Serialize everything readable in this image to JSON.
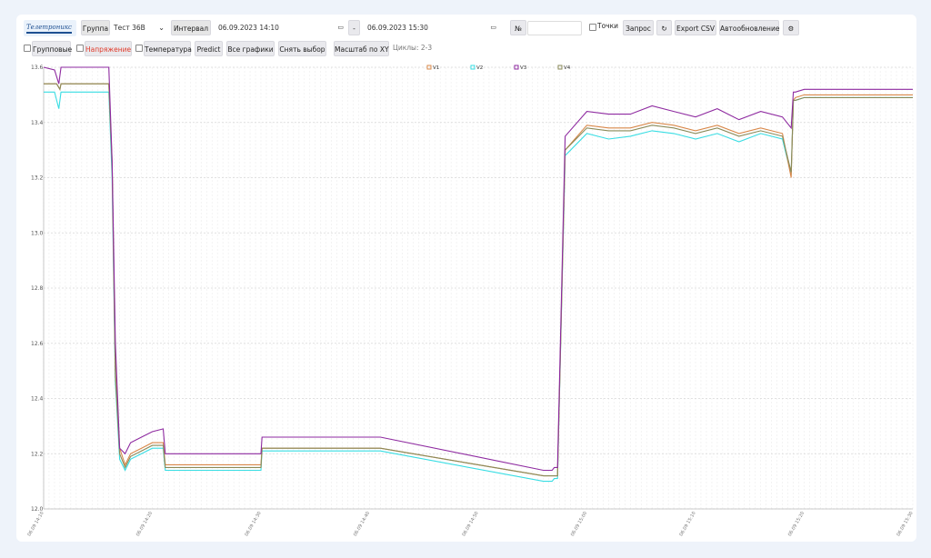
{
  "toolbar": {
    "logo_text": "Телетроникс",
    "group_label": "Группа",
    "group_value": "Тест 36В",
    "interval_label": "Интервал",
    "date_from": "06.09.2023 14:10",
    "date_sep": "-",
    "date_to": "06.09.2023 15:30",
    "number_label": "№",
    "number_value": "",
    "points_label": "Точки",
    "request_label": "Запрос",
    "refresh_icon": "refresh-icon",
    "export_label": "Export CSV",
    "autoupdate_label": "Автообновление",
    "settings_icon": "gear-icon"
  },
  "toolbar2": {
    "group_btn": "Групповые",
    "voltage_btn": "Напряжение",
    "temperature_btn": "Температура",
    "predict_btn": "Predict",
    "all_charts_btn": "Все графики",
    "deselect_btn": "Снять выбор",
    "scale_btn": "Масштаб по XY",
    "cycles_label": "Циклы: 2-3"
  },
  "colors": {
    "V1": "#d9884a",
    "V2": "#37dde3",
    "V3": "#8e2aa0",
    "V4": "#8a8a58",
    "active_tab_text": "#e03a2a"
  },
  "chart_data": {
    "type": "line",
    "title": "",
    "xlabel": "",
    "ylabel": "",
    "ylim": [
      12.0,
      13.6
    ],
    "yticks": [
      12.0,
      12.2,
      12.4,
      12.6,
      12.8,
      13.0,
      13.2,
      13.4,
      13.6
    ],
    "grid": true,
    "legend": "top-center",
    "x_range_minutes": [
      0,
      80
    ],
    "x_tick_labels": [
      "06.09 14:10",
      "06.09 14:20",
      "06.09 14:30",
      "06.09 14:40",
      "06.09 14:50",
      "06.09 15:00",
      "06.09 15:10",
      "06.09 15:20",
      "06.09 15:30"
    ],
    "series": [
      {
        "name": "V1",
        "x": [
          0,
          1.2,
          1.5,
          1.6,
          6.0,
          6.3,
          6.6,
          7.0,
          7.5,
          8.0,
          9.0,
          10.0,
          11.0,
          11.2,
          14.5,
          17.0,
          19.0,
          20.0,
          20.1,
          31.0,
          46.0,
          46.8,
          47.0,
          47.3,
          48.0,
          50,
          52,
          54,
          56,
          58,
          60,
          62,
          64,
          66,
          68,
          68.8,
          69.0,
          69.2,
          70,
          74,
          78,
          80
        ],
        "y": [
          13.54,
          13.54,
          13.52,
          13.54,
          13.54,
          13.26,
          12.5,
          12.22,
          12.16,
          12.2,
          12.22,
          12.24,
          12.24,
          12.16,
          12.16,
          12.16,
          12.16,
          12.16,
          12.22,
          12.22,
          12.12,
          12.12,
          12.12,
          12.12,
          13.3,
          13.39,
          13.38,
          13.38,
          13.4,
          13.39,
          13.37,
          13.39,
          13.36,
          13.38,
          13.36,
          13.2,
          13.48,
          13.49,
          13.5,
          13.5,
          13.5,
          13.5
        ]
      },
      {
        "name": "V2",
        "x": [
          0,
          1.0,
          1.4,
          1.6,
          6.0,
          6.3,
          6.6,
          7.0,
          7.5,
          8.0,
          9.0,
          10.0,
          11.0,
          11.2,
          14.5,
          17.0,
          19.0,
          20.0,
          20.1,
          31.0,
          46.0,
          46.8,
          47.0,
          47.3,
          48.0,
          50,
          52,
          54,
          56,
          58,
          60,
          62,
          64,
          66,
          68,
          68.8,
          69.0,
          69.2,
          70,
          74,
          78,
          80
        ],
        "y": [
          13.51,
          13.51,
          13.45,
          13.51,
          13.51,
          13.2,
          12.46,
          12.18,
          12.14,
          12.18,
          12.2,
          12.22,
          12.22,
          12.14,
          12.14,
          12.14,
          12.14,
          12.14,
          12.21,
          12.21,
          12.1,
          12.1,
          12.11,
          12.11,
          13.28,
          13.36,
          13.34,
          13.35,
          13.37,
          13.36,
          13.34,
          13.36,
          13.33,
          13.36,
          13.34,
          13.21,
          13.48,
          13.48,
          13.49,
          13.49,
          13.49,
          13.49
        ]
      },
      {
        "name": "V3",
        "x": [
          0,
          1.0,
          1.4,
          1.6,
          6.0,
          6.3,
          6.6,
          7.0,
          7.5,
          8.0,
          9.0,
          10.0,
          11.0,
          11.2,
          14.5,
          17.0,
          19.0,
          20.0,
          20.1,
          31.0,
          46.0,
          46.8,
          47.0,
          47.3,
          48.0,
          50,
          52,
          54,
          56,
          58,
          60,
          62,
          64,
          66,
          68,
          68.8,
          69.0,
          69.2,
          70,
          74,
          78,
          80
        ],
        "y": [
          13.6,
          13.59,
          13.54,
          13.6,
          13.6,
          13.26,
          12.6,
          12.22,
          12.2,
          12.24,
          12.26,
          12.28,
          12.29,
          12.2,
          12.2,
          12.2,
          12.2,
          12.2,
          12.26,
          12.26,
          12.14,
          12.14,
          12.15,
          12.15,
          13.35,
          13.44,
          13.43,
          13.43,
          13.46,
          13.44,
          13.42,
          13.45,
          13.41,
          13.44,
          13.42,
          13.38,
          13.51,
          13.51,
          13.52,
          13.52,
          13.52,
          13.52
        ]
      },
      {
        "name": "V4",
        "x": [
          0,
          1.2,
          1.5,
          1.6,
          6.0,
          6.3,
          6.6,
          7.0,
          7.5,
          8.0,
          9.0,
          10.0,
          11.0,
          11.2,
          14.5,
          17.0,
          19.0,
          20.0,
          20.1,
          31.0,
          46.0,
          46.8,
          47.0,
          47.3,
          48.0,
          50,
          52,
          54,
          56,
          58,
          60,
          62,
          64,
          66,
          68,
          68.8,
          69.0,
          69.2,
          70,
          74,
          78,
          80
        ],
        "y": [
          13.54,
          13.54,
          13.52,
          13.54,
          13.54,
          13.24,
          12.48,
          12.2,
          12.15,
          12.19,
          12.21,
          12.23,
          12.23,
          12.15,
          12.15,
          12.15,
          12.15,
          12.15,
          12.22,
          12.22,
          12.12,
          12.12,
          12.12,
          12.12,
          13.3,
          13.38,
          13.37,
          13.37,
          13.39,
          13.38,
          13.36,
          13.38,
          13.35,
          13.37,
          13.35,
          13.22,
          13.48,
          13.48,
          13.49,
          13.49,
          13.49,
          13.49
        ]
      }
    ]
  }
}
